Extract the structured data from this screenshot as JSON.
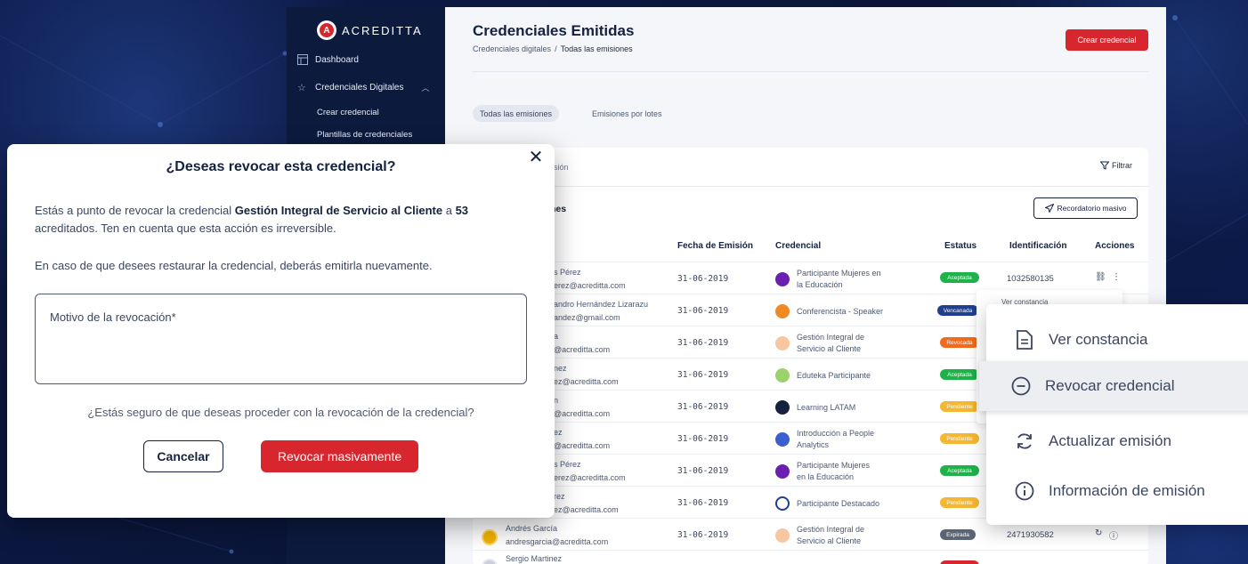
{
  "brand": {
    "name": "ACREDITTA",
    "logo_letter": "A"
  },
  "sidebar": {
    "items": [
      {
        "label": "Dashboard",
        "icon": "dashboard-icon"
      },
      {
        "label": "Credenciales Digitales",
        "icon": "star-icon"
      }
    ],
    "subitems": [
      "Crear credencial",
      "Plantillas de credenciales"
    ]
  },
  "header": {
    "title": "Credenciales Emitidas",
    "breadcrumb": {
      "parent": "Credenciales digitales",
      "separator": "/",
      "current": "Todas las emisiones"
    },
    "create_button": "Crear credencial"
  },
  "tabs": [
    "Todas las emisiones",
    "Emisiones por lotes"
  ],
  "card": {
    "search_fragment": "sión",
    "filter_label": "Filtrar",
    "section_title_fragment": "nes",
    "reminder_button": "Recordatorio masivo"
  },
  "table": {
    "columns": [
      "Fecha de Emisión",
      "Credencial",
      "Estatus",
      "Identificación",
      "Acciones"
    ],
    "rows": [
      {
        "name": "s Pérez",
        "email": "erez@acreditta.com",
        "date": "31-06-2019",
        "cred1": "Participante Mujeres en",
        "cred2": "la Educación",
        "status": "Aceptada",
        "ident": "1032580135"
      },
      {
        "name": "andro Hernández Lizarazu",
        "email": "andez@gmail.com",
        "date": "31-06-2019",
        "cred1": "Conferencista - Speaker",
        "cred2": "",
        "status": "Vencanada",
        "ident": ""
      },
      {
        "name": "a",
        "email": "@acreditta.com",
        "date": "31-06-2019",
        "cred1": "Gestión Integral de",
        "cred2": "Servicio al Cliente",
        "status": "Revocada",
        "ident": ""
      },
      {
        "name": "nez",
        "email": "ez@acreditta.com",
        "date": "31-06-2019",
        "cred1": "Eduteka Participante",
        "cred2": "",
        "status": "Aceptada",
        "ident": ""
      },
      {
        "name": "n",
        "email": "@acreditta.com",
        "date": "31-06-2019",
        "cred1": "Learning LATAM",
        "cred2": "",
        "status": "Pendiente",
        "ident": ""
      },
      {
        "name": "ez",
        "email": "@acreditta.com",
        "date": "31-06-2019",
        "cred1": "Introducción a People",
        "cred2": "Analytics",
        "status": "Pendiente",
        "ident": ""
      },
      {
        "name": "s Pérez",
        "email": "erez@acreditta.com",
        "date": "31-06-2019",
        "cred1": "Participante Mujeres",
        "cred2": "en la Educación",
        "status": "Aceptada",
        "ident": ""
      },
      {
        "name": "rez",
        "email": "ez@acreditta.com",
        "date": "31-06-2019",
        "cred1": "Participante Destacado",
        "cred2": "",
        "status": "Pendiente",
        "ident": ""
      },
      {
        "name": "Andrés García",
        "email": "andresgarcia@acreditta.com",
        "date": "31-06-2019",
        "cred1": "Gestión Integral de",
        "cred2": "Servicio al Cliente",
        "status": "Expirada",
        "ident": "2471930582"
      },
      {
        "name": "Sergio Martinez",
        "email": "",
        "date": "",
        "cred1": "",
        "cred2": "",
        "status": "",
        "ident": ""
      }
    ]
  },
  "mini_menu": {
    "first_item": "Ver constancia"
  },
  "context_menu": {
    "items": [
      {
        "label": "Ver constancia",
        "icon": "document-icon"
      },
      {
        "label": "Revocar credencial",
        "icon": "minus-circle-icon"
      },
      {
        "label": "Actualizar emisión",
        "icon": "refresh-icon"
      },
      {
        "label": "Información de emisión",
        "icon": "info-icon"
      }
    ]
  },
  "modal": {
    "title": "¿Deseas revocar esta credencial?",
    "text_prefix": "Estás a punto de revocar la credencial ",
    "credential_name": "Gestión Integral de Servicio al Cliente",
    "text_middle": " a ",
    "count": "53",
    "text_suffix": " acreditados. Ten en cuenta que esta acción es irreversible.",
    "restore_note": "En caso de que desees restaurar la credencial, deberás emitirla nuevamente.",
    "reason_placeholder": "Motivo de la revocación*",
    "confirm_question": "¿Estás seguro de que deseas proceder con la revocación de la credencial?",
    "cancel_label": "Cancelar",
    "revoke_label": "Revocar masivamente"
  },
  "colors": {
    "accent_red": "#d8262e",
    "navy": "#14223f",
    "status_aceptada": "#1fb24a",
    "status_vencanada": "#1f3f8f",
    "status_revocada": "#f26a1b",
    "status_pendiente": "#f5b731",
    "status_expirada": "#5b6475"
  }
}
